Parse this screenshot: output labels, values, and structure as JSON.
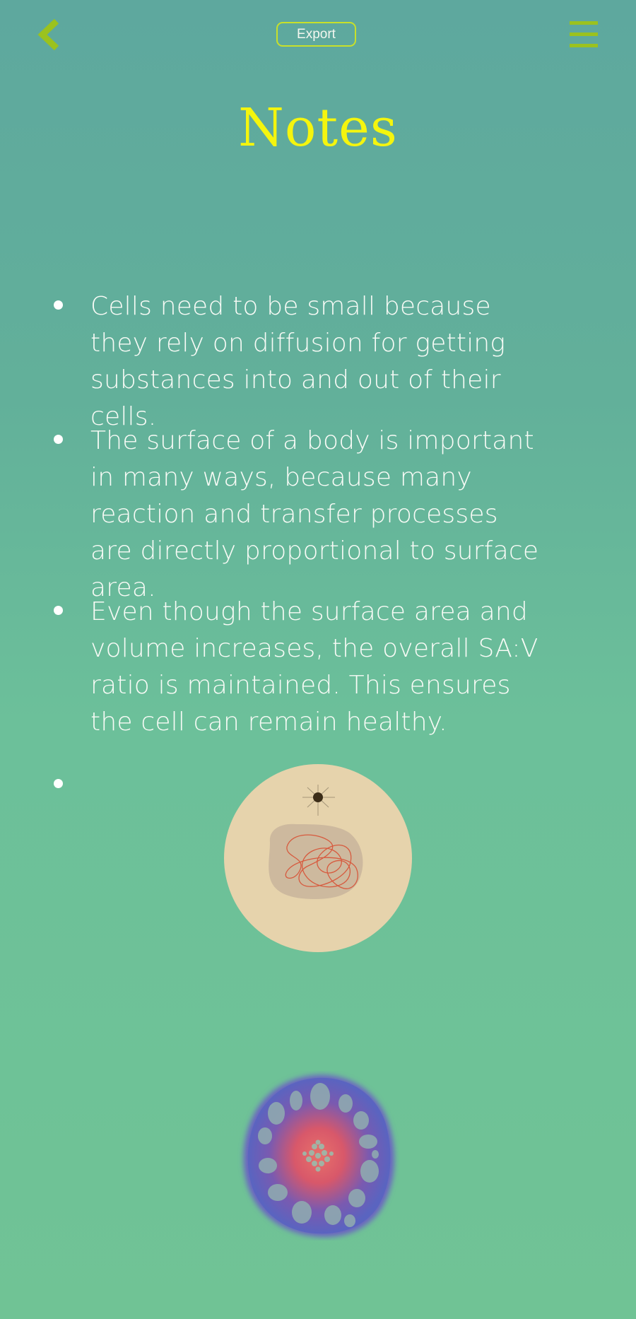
{
  "header": {
    "back_icon": "chevron-left-icon",
    "export_label": "Export",
    "menu_icon": "hamburger-menu-icon"
  },
  "page": {
    "title": "Notes"
  },
  "notes": [
    "Cells need to be small because they rely on diffusion for getting substances into and out of their cells.",
    "The surface of a body is important in many ways, because many reaction and transfer processes are directly proportional to surface area.",
    "Even though the surface area and volume increases, the overall SA:V ratio is maintained. This ensures the cell can remain healthy.",
    ""
  ],
  "colors": {
    "accent_green": "#9bc21e",
    "title_yellow": "#f4f50e",
    "export_border": "#c8e02a",
    "text": "#f8fbf6"
  },
  "images": {
    "cell": "cell-illustration",
    "tissue": "tissue-cross-section-illustration"
  }
}
